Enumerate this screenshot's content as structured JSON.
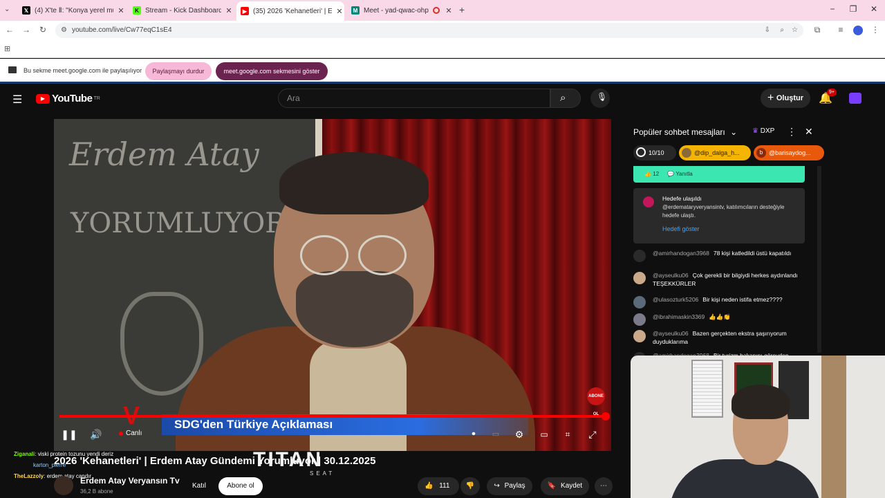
{
  "browser": {
    "tabs": [
      {
        "title": "(4) X'te Ⅱ: \"Konya yerel muhabir",
        "icon": "x-icon",
        "color": "#000000"
      },
      {
        "title": "Stream - Kick Dashboard",
        "icon": "kick-icon",
        "color": "#53fc18"
      },
      {
        "title": "(35) 2026 'Kehanetleri' | Erde",
        "icon": "youtube-icon",
        "color": "#ff0000"
      },
      {
        "title": "Meet - yad-qwac-ohp",
        "icon": "meet-icon",
        "color": "#00897b"
      }
    ],
    "url": "youtube.com/live/Cw77eqC1sE4"
  },
  "share_bar": {
    "message": "Bu sekme meet.google.com ile paylaşılıyor",
    "stop_label": "Paylaşmayı durdur",
    "show_label": "meet.google.com sekmesini göster"
  },
  "youtube": {
    "logo_text": "YouTube",
    "country": "TR",
    "search_placeholder": "Ara",
    "create_label": "Oluştur",
    "notif_count": "9+"
  },
  "player": {
    "lower_third": "SDG'den Türkiye Açıklaması",
    "live_label": "Canlı",
    "abone_badge": "ABONE OL",
    "chalk_top": "Erdem Atay",
    "chalk_mid": "YORUMLUYOR",
    "progress": 1.0
  },
  "video": {
    "title": "2026 'Kehanetleri' | Erdem Atay Gündemi Yorumluyor | 30.12.2025",
    "channel": "Erdem Atay Veryansın Tv",
    "subs": "36,2 B abone",
    "join_label": "Katıl",
    "subscribe_label": "Abone ol",
    "likes": "111",
    "share_label": "Paylaş",
    "save_label": "Kaydet",
    "titan_logo": "TITAN",
    "titan_sub": "SEAT"
  },
  "overlay_chat": [
    {
      "user": "Ziganali",
      "text": "viski protein tozunu yendi deriz"
    },
    {
      "user": "karton_pierre",
      "text": ""
    },
    {
      "user": "TheLazzoly",
      "text": "erdem atay candır"
    }
  ],
  "chat": {
    "title": "Popüler sohbet mesajları",
    "dxp": "DXP",
    "chips": [
      {
        "label": "10/10",
        "color": "#272727"
      },
      {
        "label": "@dip_dalga_h...",
        "color": "#f4b400"
      },
      {
        "label": "@barisaydog...",
        "color": "#e8590c"
      }
    ],
    "green_count": "12",
    "reply_label": "Yanıtla",
    "goal_title": "Hedefe ulaşıldı",
    "goal_text": "@erdemataryveryansintv, katılımcıların desteğiyle hedefe ulaştı.",
    "goal_link": "Hedefi göster",
    "messages": [
      {
        "author": "@amirhandogan3968",
        "text": "78 kişi katledildi üstü kapatıldı",
        "avatar": "#2a2a2a"
      },
      {
        "author": "@ayseulku06",
        "text": "Çok gerekli bir bilgiydi herkes aydınlandı TEŞEKKÜRLER",
        "avatar": "#c9a98a"
      },
      {
        "author": "@ulasozturk5206",
        "text": "Bir kişi neden istifa etmez????",
        "avatar": "#5a6a7a"
      },
      {
        "author": "@ibrahimaskin3369",
        "text": "👍👍👏",
        "avatar": "#7a7a8a"
      },
      {
        "author": "@ayseulku06",
        "text": "Bazen gerçekten ekstra şaşırıyorum duyduklarıma",
        "avatar": "#c9a98a"
      },
      {
        "author": "@amirhandogan3968",
        "text": "Bir turizm bakanını görevden",
        "avatar": "#2a2a2a"
      }
    ]
  }
}
